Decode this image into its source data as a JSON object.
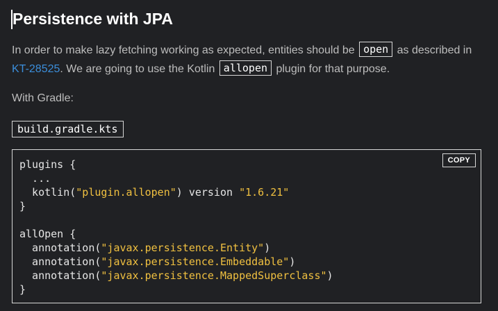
{
  "heading": "Persistence with JPA",
  "intro": {
    "part1": "In order to make lazy fetching working as expected, entities should be",
    "code1": "open",
    "part2": "as described in",
    "link": "KT-28525",
    "part3": ". We are going to use the Kotlin",
    "code2": "allopen",
    "part4": "plugin for that purpose."
  },
  "gradle_label": "With Gradle:",
  "file_tab": "build.gradle.kts",
  "copy_label": "COPY",
  "code": {
    "l1": "plugins {",
    "l2": "  ...",
    "l3_a": "  kotlin(",
    "l3_b": "\"plugin.allopen\"",
    "l3_c": ") version ",
    "l3_d": "\"1.6.21\"",
    "l4": "}",
    "l5": "",
    "l6": "allOpen {",
    "l7_a": "  annotation(",
    "l7_b": "\"javax.persistence.Entity\"",
    "l7_c": ")",
    "l8_a": "  annotation(",
    "l8_b": "\"javax.persistence.Embeddable\"",
    "l8_c": ")",
    "l9_a": "  annotation(",
    "l9_b": "\"javax.persistence.MappedSuperclass\"",
    "l9_c": ")",
    "l10": "}"
  },
  "colors": {
    "background": "#202124",
    "link": "#3b8edb",
    "string": "#f0c040"
  }
}
